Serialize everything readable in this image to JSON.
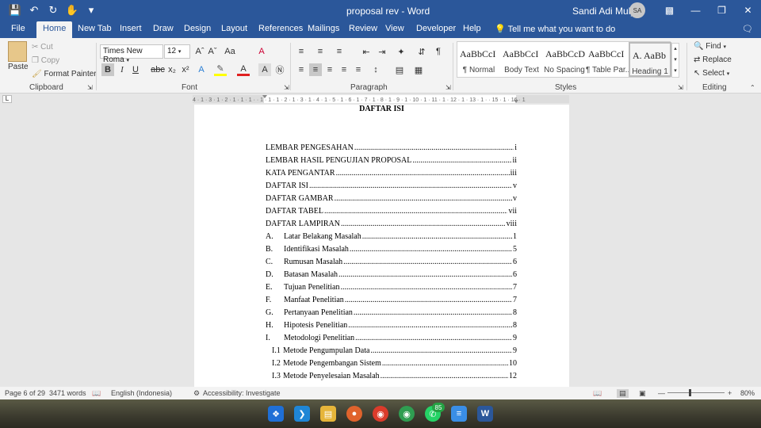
{
  "titlebar": {
    "doc_title": "proposal rev  -  Word",
    "user_name": "Sandi Adi Mulya",
    "user_initials": "SA"
  },
  "tabs": [
    "File",
    "Home",
    "New Tab",
    "Insert",
    "Draw",
    "Design",
    "Layout",
    "References",
    "Mailings",
    "Review",
    "View",
    "Developer",
    "Help"
  ],
  "tell_me": "Tell me what you want to do",
  "ribbon": {
    "clipboard": {
      "paste": "Paste",
      "cut": "Cut",
      "copy": "Copy",
      "format_painter": "Format Painter",
      "label": "Clipboard"
    },
    "font": {
      "name": "Times New Roma",
      "size": "12",
      "label": "Font"
    },
    "paragraph": {
      "label": "Paragraph"
    },
    "styles": {
      "label": "Styles",
      "items": [
        {
          "sample": "AaBbCcI",
          "name": "¶ Normal"
        },
        {
          "sample": "AaBbCcI",
          "name": "Body Text"
        },
        {
          "sample": "AaBbCcD",
          "name": "No Spacing"
        },
        {
          "sample": "AaBbCcI",
          "name": "¶ Table Par..."
        },
        {
          "sample": "A.  AaBb",
          "name": "Heading 1"
        }
      ]
    },
    "editing": {
      "find": "Find",
      "replace": "Replace",
      "select": "Select",
      "label": "Editing"
    }
  },
  "document": {
    "title": "DAFTAR ISI",
    "entries": [
      {
        "num": "",
        "text": "LEMBAR PENGESAHAN",
        "page": "i"
      },
      {
        "num": "",
        "text": "LEMBAR HASIL PENGUJIAN PROPOSAL",
        "page": "ii"
      },
      {
        "num": "",
        "text": "KATA PENGANTAR",
        "page": "iii"
      },
      {
        "num": "",
        "text": "DAFTAR ISI",
        "page": "v"
      },
      {
        "num": "",
        "text": "DAFTAR GAMBAR",
        "page": "v"
      },
      {
        "num": "",
        "text": "DAFTAR TABEL",
        "page": "vii"
      },
      {
        "num": "",
        "text": "DAFTAR LAMPIRAN",
        "page": "viii"
      },
      {
        "num": "A.",
        "text": "Latar Belakang Masalah",
        "page": "1"
      },
      {
        "num": "B.",
        "text": "Identifikasi Masalah",
        "page": "5"
      },
      {
        "num": "C.",
        "text": "Rumusan Masalah",
        "page": "6"
      },
      {
        "num": "D.",
        "text": "Batasan Masalah",
        "page": "6"
      },
      {
        "num": "E.",
        "text": "Tujuan Penelitian",
        "page": "7"
      },
      {
        "num": "F.",
        "text": "Manfaat Penelitian",
        "page": "7"
      },
      {
        "num": "G.",
        "text": "Pertanyaan Penelitian",
        "page": "8"
      },
      {
        "num": "H.",
        "text": "Hipotesis Penelitian",
        "page": "8"
      },
      {
        "num": "I.",
        "text": "Metodologi Penelitian",
        "page": "9"
      },
      {
        "num": "I.1",
        "text": "Metode Pengumpulan Data",
        "page": "9"
      },
      {
        "num": "I.2",
        "text": "Metode Pengembangan Sistem",
        "page": "10"
      },
      {
        "num": "I.3",
        "text": "Metode Penyelesaian Masalah",
        "page": "12"
      }
    ]
  },
  "status": {
    "page": "Page 6 of 29",
    "words": "3471 words",
    "language": "English (Indonesia)",
    "accessibility": "Accessibility: Investigate",
    "zoom": "80%"
  },
  "taskbar": {
    "chrome_badge": "85"
  }
}
